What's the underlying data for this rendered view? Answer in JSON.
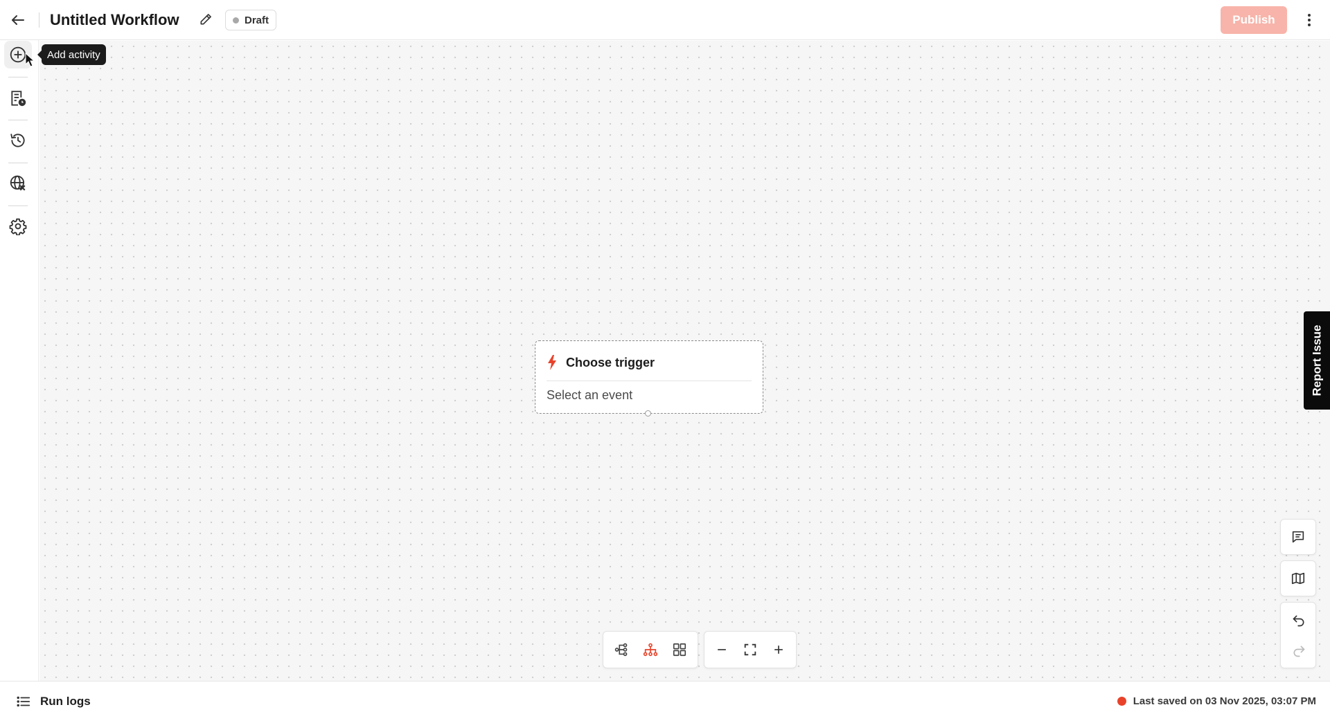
{
  "header": {
    "title": "Untitled Workflow",
    "status": "Draft",
    "publish_label": "Publish"
  },
  "sidebar": {
    "tooltip": "Add activity",
    "items": [
      {
        "icon": "add-circle-icon"
      },
      {
        "icon": "notes-clock-icon"
      },
      {
        "icon": "history-icon"
      },
      {
        "icon": "globe-variable-icon"
      },
      {
        "icon": "gear-icon"
      }
    ]
  },
  "trigger_node": {
    "title": "Choose trigger",
    "subtitle": "Select an event",
    "icon": "lightning-icon"
  },
  "toolbar": {
    "layout_buttons": [
      "branch-layout-icon",
      "tree-layout-icon",
      "grid-layout-icon"
    ],
    "zoom_buttons": [
      "zoom-out-icon",
      "fit-screen-icon",
      "zoom-in-icon"
    ]
  },
  "right_controls": {
    "report_issue": "Report Issue",
    "buttons": [
      "comment-icon",
      "map-icon",
      "undo-icon",
      "redo-icon"
    ]
  },
  "footer": {
    "run_logs": "Run logs",
    "last_saved": "Last saved on 03 Nov 2025, 03:07 PM"
  },
  "colors": {
    "accent": "#e8432a",
    "publish_disabled": "#f8b4aa",
    "canvas_bg": "#f6f6f6",
    "tooltip_bg": "#1c1c1c"
  }
}
